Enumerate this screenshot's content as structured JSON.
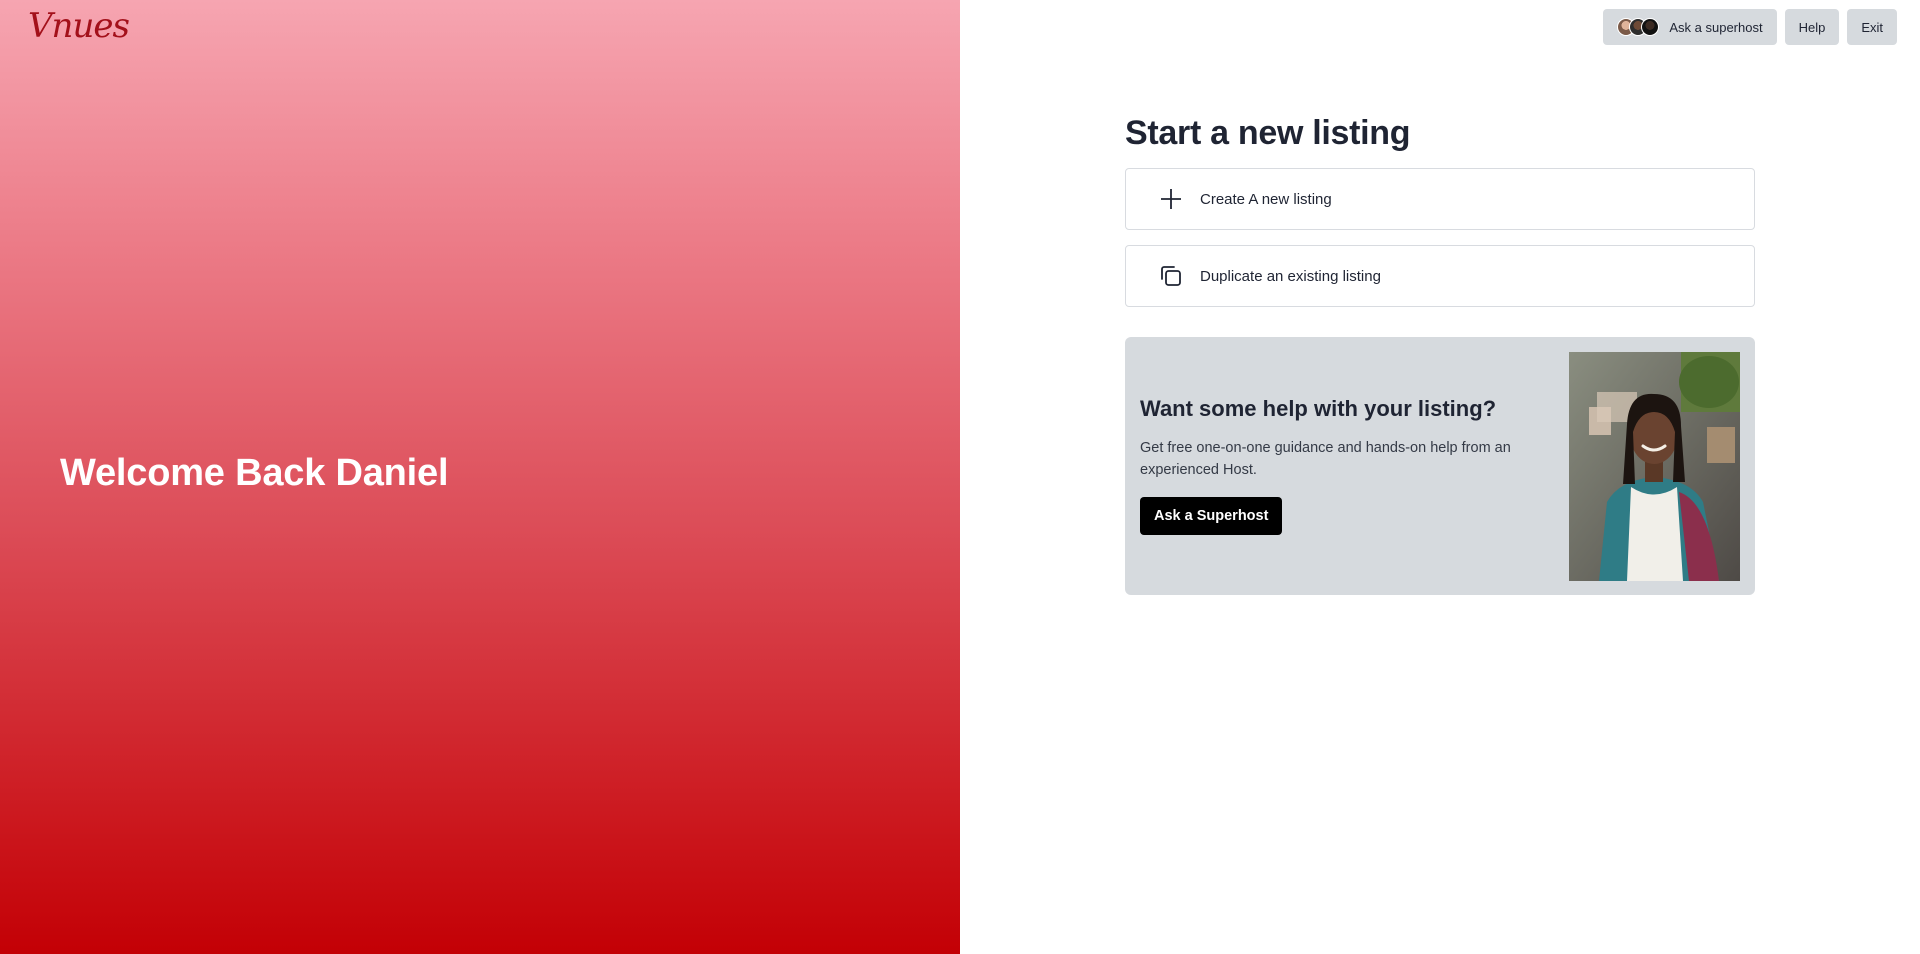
{
  "brand": {
    "logo_text": "Vnues",
    "primary_color": "#c30005",
    "gradient_top": "#f6a5b1"
  },
  "hero": {
    "welcome": "Welcome Back Daniel"
  },
  "topbar": {
    "ask_superhost_label": "Ask a superhost",
    "help_label": "Help",
    "exit_label": "Exit"
  },
  "main": {
    "title": "Start a new listing",
    "options": [
      {
        "label": "Create A new listing",
        "icon": "plus-icon"
      },
      {
        "label": "Duplicate an existing listing",
        "icon": "duplicate-icon"
      }
    ]
  },
  "help_card": {
    "title": "Want some help with your listing?",
    "description": "Get free one-on-one guidance and hands-on help from an experienced Host.",
    "cta_label": "Ask a Superhost"
  }
}
